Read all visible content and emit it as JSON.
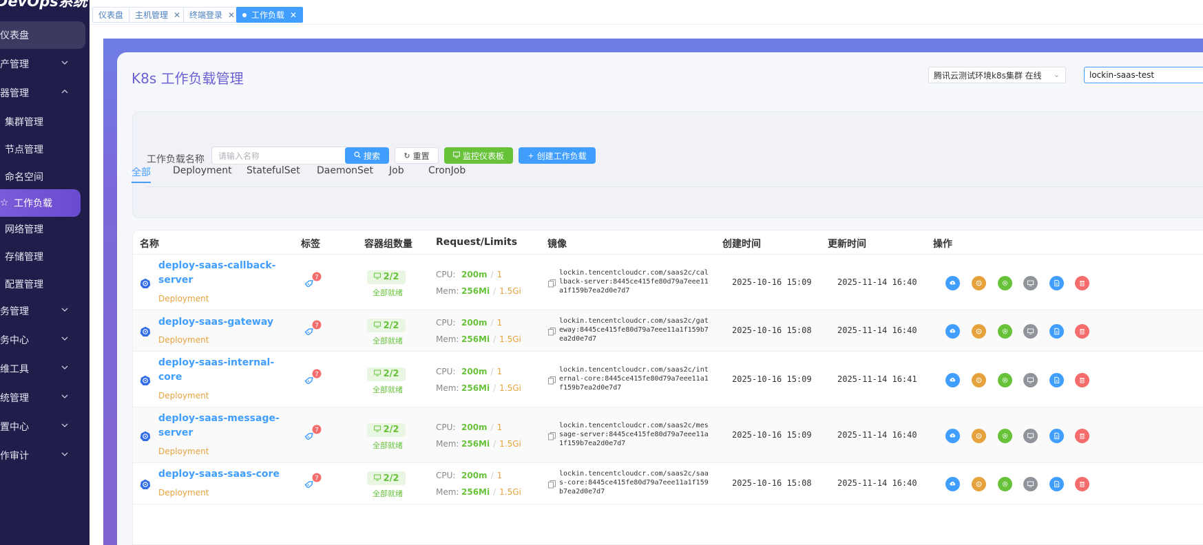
{
  "app": {
    "logo": "DevOps系统"
  },
  "sidebar": {
    "items": [
      {
        "label": "仪表盘",
        "type": "top",
        "active": true,
        "chevron": ""
      },
      {
        "label": "产管理",
        "type": "top",
        "chevron": "down"
      },
      {
        "label": "器管理",
        "type": "top",
        "chevron": "up"
      },
      {
        "label": "集群管理",
        "type": "sub"
      },
      {
        "label": "节点管理",
        "type": "sub"
      },
      {
        "label": "命名空间",
        "type": "sub"
      },
      {
        "label": "工作负载",
        "type": "sub",
        "active": true,
        "icon": "star-icon"
      },
      {
        "label": "网络管理",
        "type": "sub"
      },
      {
        "label": "存储管理",
        "type": "sub"
      },
      {
        "label": "配置管理",
        "type": "sub"
      },
      {
        "label": "务管理",
        "type": "top",
        "chevron": "down"
      },
      {
        "label": "务中心",
        "type": "top",
        "chevron": "down"
      },
      {
        "label": "维工具",
        "type": "top",
        "chevron": "down"
      },
      {
        "label": "统管理",
        "type": "top",
        "chevron": "down"
      },
      {
        "label": "置中心",
        "type": "top",
        "chevron": "down"
      },
      {
        "label": "作审计",
        "type": "top",
        "chevron": "down"
      }
    ]
  },
  "page_tabs": [
    {
      "label": "仪表盘",
      "closable": false,
      "active": false
    },
    {
      "label": "主机管理",
      "closable": true,
      "active": false
    },
    {
      "label": "终端登录",
      "closable": true,
      "active": false
    },
    {
      "label": "工作负载",
      "closable": true,
      "active": true
    }
  ],
  "header": {
    "title": "K8s 工作负载管理",
    "cluster_select": "腾讯云测试环境k8s集群 在线",
    "namespace_value": "lockin-saas-test"
  },
  "filter": {
    "label": "工作负载名称",
    "placeholder": "请输入名称",
    "search_label": "搜索",
    "reset_label": "重置",
    "monitor_label": "监控仪表板",
    "create_label": "创建工作负载"
  },
  "workload_tabs": [
    "全部",
    "Deployment",
    "StatefulSet",
    "DaemonSet",
    "Job",
    "CronJob"
  ],
  "workload_tab_active": "全部",
  "table": {
    "columns": [
      "名称",
      "标签",
      "容器组数量",
      "Request/Limits",
      "镜像",
      "创建时间",
      "更新时间",
      "操作"
    ],
    "rows": [
      {
        "name": "deploy-saas-callback-server",
        "kind": "Deployment",
        "tag_count": "7",
        "pods": "2/2",
        "pod_status": "全部就绪",
        "cpu_req": "200m",
        "cpu_lim": "1",
        "mem_req": "256Mi",
        "mem_lim": "1.5Gi",
        "image": "lockin.tencentcloudcr.com/saas2c/callback-server:8445ce415fe80d79a7eee11a1f159b7ea2d0e7d7",
        "created": "2025-10-16 15:09",
        "updated": "2025-11-14 16:40"
      },
      {
        "name": "deploy-saas-gateway",
        "kind": "Deployment",
        "tag_count": "7",
        "pods": "2/2",
        "pod_status": "全部就绪",
        "cpu_req": "200m",
        "cpu_lim": "1",
        "mem_req": "256Mi",
        "mem_lim": "1.5Gi",
        "image": "lockin.tencentcloudcr.com/saas2c/gateway:8445ce415fe80d79a7eee11a1f159b7ea2d0e7d7",
        "created": "2025-10-16 15:08",
        "updated": "2025-11-14 16:40"
      },
      {
        "name": "deploy-saas-internal-core",
        "kind": "Deployment",
        "tag_count": "7",
        "pods": "2/2",
        "pod_status": "全部就绪",
        "cpu_req": "200m",
        "cpu_lim": "1",
        "mem_req": "256Mi",
        "mem_lim": "1.5Gi",
        "image": "lockin.tencentcloudcr.com/saas2c/internal-core:8445ce415fe80d79a7eee11a1f159b7ea2d0e7d7",
        "created": "2025-10-16 15:09",
        "updated": "2025-11-14 16:41"
      },
      {
        "name": "deploy-saas-message-server",
        "kind": "Deployment",
        "tag_count": "7",
        "pods": "2/2",
        "pod_status": "全部就绪",
        "cpu_req": "200m",
        "cpu_lim": "1",
        "mem_req": "256Mi",
        "mem_lim": "1.5Gi",
        "image": "lockin.tencentcloudcr.com/saas2c/message-server:8445ce415fe80d79a7eee11a1f159b7ea2d0e7d7",
        "created": "2025-10-16 15:09",
        "updated": "2025-11-14 16:40"
      },
      {
        "name": "deploy-saas-saas-core",
        "kind": "Deployment",
        "tag_count": "7",
        "pods": "2/2",
        "pod_status": "全部就绪",
        "cpu_req": "200m",
        "cpu_lim": "1",
        "mem_req": "256Mi",
        "mem_lim": "1.5Gi",
        "image": "lockin.tencentcloudcr.com/saas2c/saas-core:8445ce415fe80d79a7eee11a1f159b7ea2d0e7d7",
        "created": "2025-10-16 15:08",
        "updated": "2025-11-14 16:40"
      }
    ]
  },
  "row_actions": [
    {
      "icon": "cloud-upload-icon",
      "color": "#409eff"
    },
    {
      "icon": "scale-icon",
      "color": "#e6a23c"
    },
    {
      "icon": "settings-icon",
      "color": "#67c23a"
    },
    {
      "icon": "terminal-icon",
      "color": "#909399"
    },
    {
      "icon": "document-icon",
      "color": "#409eff"
    },
    {
      "icon": "delete-icon",
      "color": "#f56c6c"
    }
  ],
  "colors": {
    "sidebar_bg": "#1f1d4a",
    "accent": "#409eff",
    "success": "#67c23a",
    "warning": "#e6a23c",
    "danger": "#f56c6c",
    "title": "#6a62d2"
  }
}
